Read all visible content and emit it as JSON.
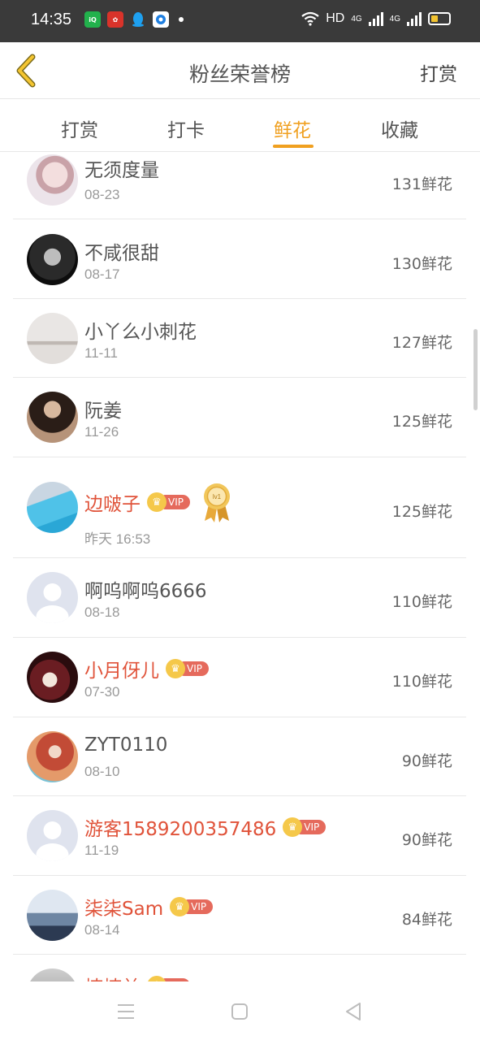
{
  "status_bar": {
    "time": "14:35",
    "network": "HD",
    "signal_1": "4G",
    "signal_2": "4G",
    "colors": {
      "iqiyi": "#22b14c",
      "red_app": "#d9332a",
      "qq": "#1ea0f0",
      "browser": "#1f7fe0",
      "battery": "#f2c330"
    }
  },
  "header": {
    "title": "粉丝荣誉榜",
    "action": "打赏"
  },
  "tabs": [
    {
      "label": "打赏"
    },
    {
      "label": "打卡"
    },
    {
      "label": "鲜花",
      "active": true
    },
    {
      "label": "收藏"
    }
  ],
  "accent_color": "#f0a020",
  "vip_label": "VIP",
  "medal_label": "lv1",
  "fans": [
    {
      "name": "无须度量",
      "date": "08-23",
      "amount": "131鲜花",
      "vip": false
    },
    {
      "name": "不咸很甜",
      "date": "08-17",
      "amount": "130鲜花",
      "vip": false
    },
    {
      "name": "小丫么小刺花",
      "date": "11-11",
      "amount": "127鲜花",
      "vip": false
    },
    {
      "name": "阮姜",
      "date": "11-26",
      "amount": "125鲜花",
      "vip": false
    },
    {
      "name": "边啵子",
      "date": "昨天 16:53",
      "amount": "125鲜花",
      "vip": true,
      "medal": true
    },
    {
      "name": "啊呜啊呜6666",
      "date": "08-18",
      "amount": "110鲜花",
      "vip": false
    },
    {
      "name": "小月伢儿",
      "date": "07-30",
      "amount": "110鲜花",
      "vip": true
    },
    {
      "name": "ZYT0110",
      "date": "08-10",
      "amount": "90鲜花",
      "vip": false
    },
    {
      "name": "游客1589200357486",
      "date": "11-19",
      "amount": "90鲜花",
      "vip": true
    },
    {
      "name": "柒柒Sam",
      "date": "08-14",
      "amount": "84鲜花",
      "vip": true
    },
    {
      "name": "楠楠兰",
      "date": "",
      "amount": "",
      "vip": true
    }
  ]
}
